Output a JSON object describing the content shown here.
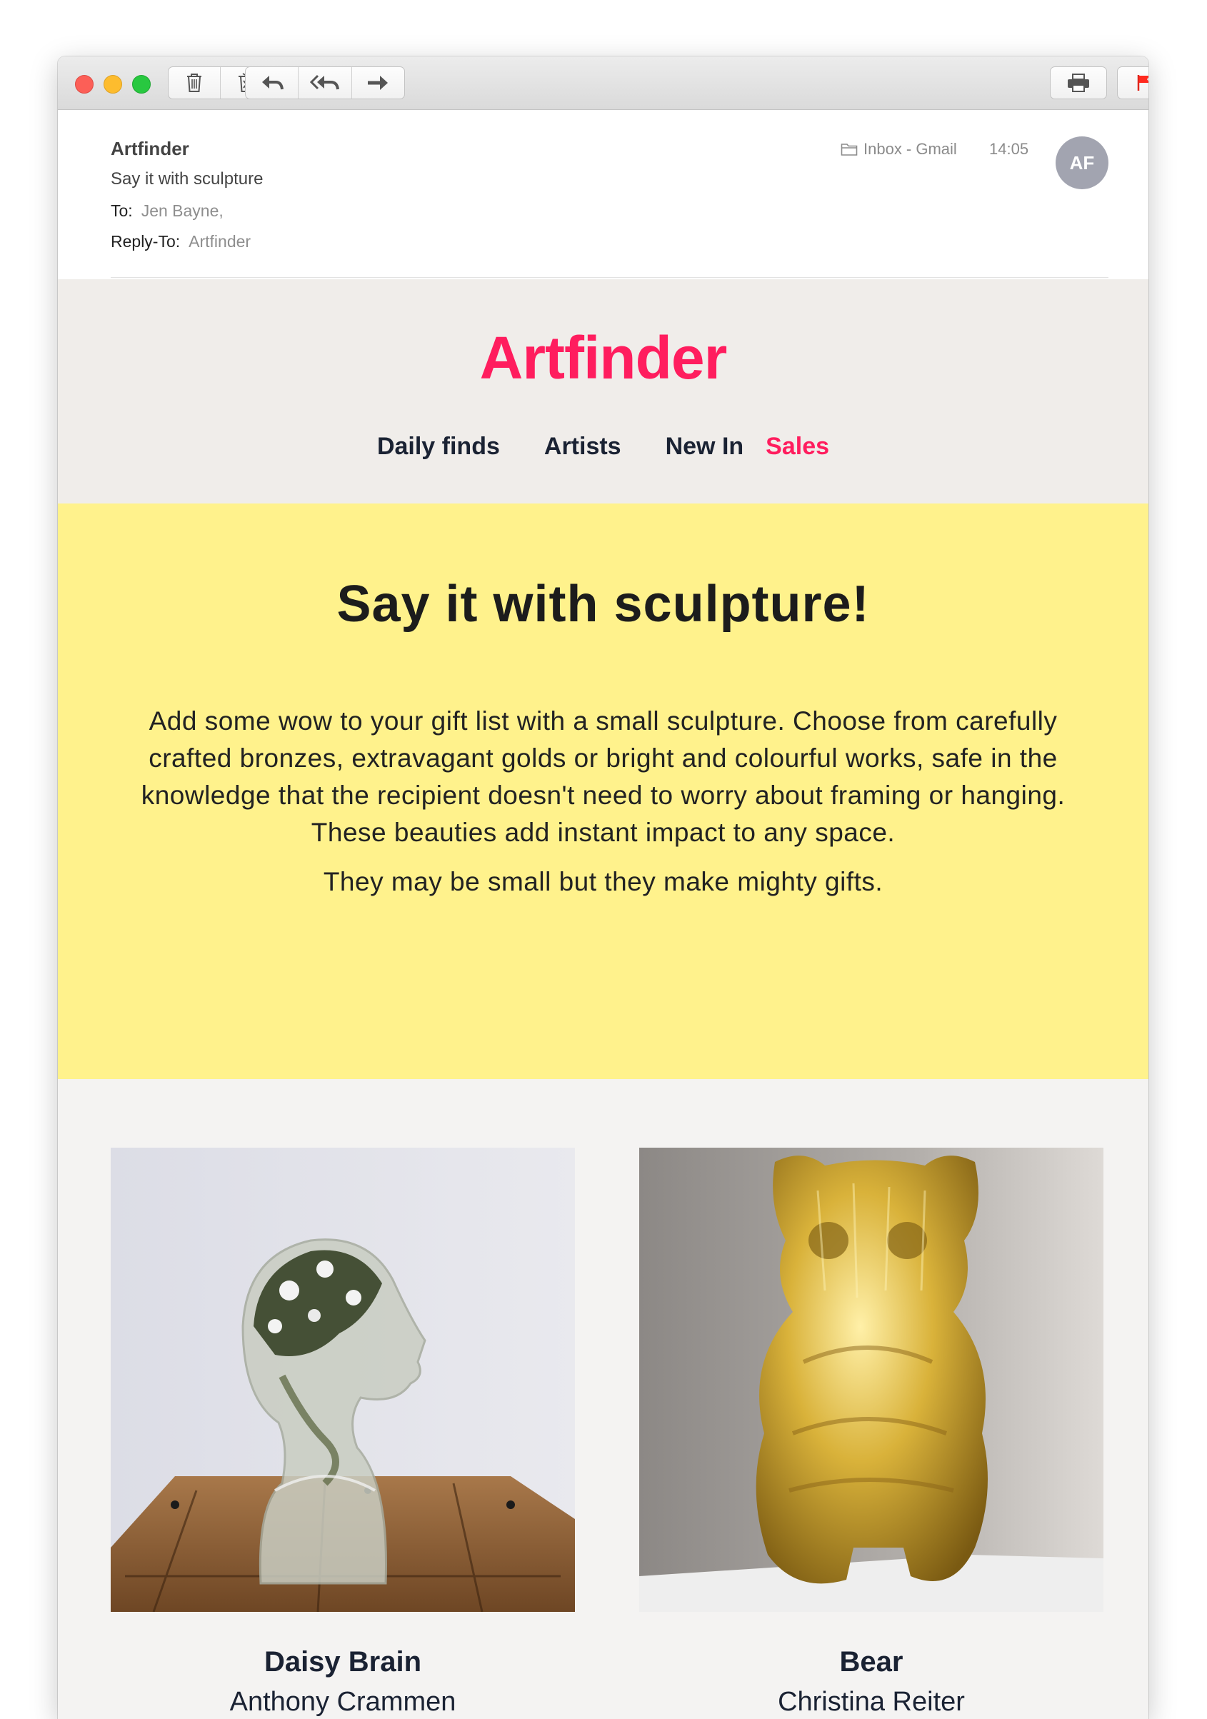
{
  "message": {
    "from": "Artfinder",
    "subject": "Say it with sculpture",
    "to_label": "To:",
    "to_value": "Jen Bayne,",
    "replyto_label": "Reply-To:",
    "replyto_value": "Artfinder",
    "mailbox": "Inbox - Gmail",
    "time": "14:05",
    "avatar_initials": "AF"
  },
  "toolbar": {
    "icons": [
      "trash-icon",
      "junk-icon",
      "reply-icon",
      "reply-all-icon",
      "forward-icon",
      "print-icon",
      "flag-icon",
      "chevron-down-icon"
    ]
  },
  "email": {
    "logo": "Artfinder",
    "nav": [
      "Daily finds",
      "Artists",
      "New In",
      "Sales"
    ],
    "hero_title": "Say it with sculpture!",
    "hero_body": "Add some wow to your gift list with a small sculpture. Choose from carefully crafted bronzes, extravagant golds or bright and colourful works, safe in the knowledge that the recipient doesn't need to worry about framing or hanging. These beauties add instant impact to any space.",
    "hero_tagline": "They may be small but they make mighty gifts.",
    "products": [
      {
        "title": "Daisy Brain",
        "artist": "Anthony Crammen"
      },
      {
        "title": "Bear",
        "artist": "Christina Reiter"
      }
    ]
  },
  "colors": {
    "brand": "#ff1d5e",
    "hero_bg": "#fff28c",
    "nav_bg": "#f0edea",
    "products_bg": "#f4f3f2",
    "text_dark": "#1a2233"
  }
}
